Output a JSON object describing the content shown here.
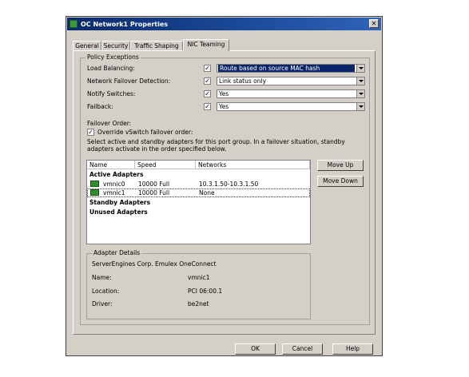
{
  "window": {
    "title": "OC Network1 Properties",
    "close_glyph": "✕"
  },
  "tabs": [
    {
      "label": "General"
    },
    {
      "label": "Security"
    },
    {
      "label": "Traffic Shaping"
    },
    {
      "label": "NIC Teaming",
      "active": true
    }
  ],
  "policy": {
    "group_label": "Policy Exceptions",
    "rows": [
      {
        "label": "Load Balancing:",
        "checked": true,
        "value": "Route based on source MAC hash"
      },
      {
        "label": "Network Failover Detection:",
        "checked": true,
        "value": "Link status only"
      },
      {
        "label": "Notify Switches:",
        "checked": true,
        "value": "Yes"
      },
      {
        "label": "Failback:",
        "checked": true,
        "value": "Yes"
      }
    ],
    "check_glyph": "✓"
  },
  "failover": {
    "label": "Failover Order:",
    "override_label": "Override vSwitch failover order:",
    "override_checked": true,
    "description_line1": "Select active and standby adapters for this port group.  In a failover situation, standby",
    "description_line2": "adapters activate  in the order specified below."
  },
  "adapters": {
    "columns": [
      "Name",
      "Speed",
      "Networks"
    ],
    "groups": {
      "active": "Active Adapters",
      "standby": "Standby Adapters",
      "unused": "Unused Adapters"
    },
    "active_rows": [
      {
        "name": "vmnic0",
        "speed": "10000 Full",
        "networks": "10.3.1.50-10.3.1.50",
        "selected": false
      },
      {
        "name": "vmnic1",
        "speed": "10000 Full",
        "networks": "None",
        "selected": true
      }
    ],
    "move_up": "Move Up",
    "move_down": "Move Down"
  },
  "details": {
    "group_label": "Adapter Details",
    "adapter": "ServerEngines Corp. Emulex OneConnect",
    "name_label": "Name:",
    "name_value": "vmnic1",
    "location_label": "Location:",
    "location_value": "PCI 06:00.1",
    "driver_label": "Driver:",
    "driver_value": "be2net"
  },
  "footer": {
    "ok": "OK",
    "cancel": "Cancel",
    "help": "Help"
  }
}
